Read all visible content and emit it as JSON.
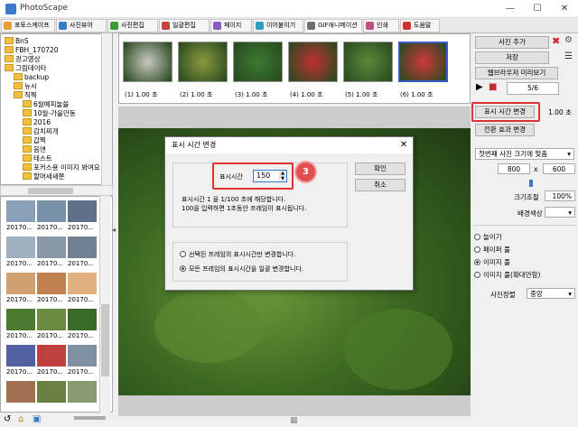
{
  "app": {
    "title": "PhotoScape"
  },
  "tabs": [
    {
      "label": "포토스케이프",
      "color": "#e8a030"
    },
    {
      "label": "사진뷰어",
      "color": "#3a78c8"
    },
    {
      "label": "사진편집",
      "color": "#3a9a3a"
    },
    {
      "label": "일괄편집",
      "color": "#c84040"
    },
    {
      "label": "페이지",
      "color": "#8a5ac8"
    },
    {
      "label": "이어붙이기",
      "color": "#30a0c0"
    },
    {
      "label": "GIF애니메이션",
      "color": "#707070"
    },
    {
      "label": "인쇄",
      "color": "#c05080"
    },
    {
      "label": "도움말",
      "color": "#d03030"
    }
  ],
  "tree": {
    "items": [
      {
        "label": "BnS",
        "indent": 0
      },
      {
        "label": "FBH_170720",
        "indent": 0
      },
      {
        "label": "광고영상",
        "indent": 0
      },
      {
        "label": "그림데이타",
        "indent": 0
      },
      {
        "label": "backup",
        "indent": 1
      },
      {
        "label": "뉴시",
        "indent": 1
      },
      {
        "label": "직찍",
        "indent": 1
      },
      {
        "label": "6월예피눌쓸",
        "indent": 2
      },
      {
        "label": "10월-가을만동",
        "indent": 2
      },
      {
        "label": "2016",
        "indent": 2
      },
      {
        "label": "감치찌개",
        "indent": 2
      },
      {
        "label": "갑찍",
        "indent": 2
      },
      {
        "label": "음앤",
        "indent": 2
      },
      {
        "label": "테스트",
        "indent": 2
      },
      {
        "label": "포커스용 이미지 봐여요",
        "indent": 2
      },
      {
        "label": "할머새새쭌",
        "indent": 2
      }
    ]
  },
  "thumbs": {
    "labels": [
      "20170...",
      "20170...",
      "20170..."
    ],
    "colors": [
      "#8aa0b8",
      "#7890a8",
      "#607088",
      "#a0b0c0",
      "#8898a8",
      "#708090",
      "#d0a070",
      "#c08050",
      "#e0b080",
      "#4a7a30",
      "#6a8a40",
      "#3a6a28",
      "#5060a0",
      "#c04040",
      "#8090a0",
      "#a07050",
      "#6a8040",
      "#8a9a70"
    ]
  },
  "frames": {
    "items": [
      {
        "label": "(1) 1.00 초",
        "color": "#c8c8c0"
      },
      {
        "label": "(2) 1.00 초",
        "color": "#8a9a40"
      },
      {
        "label": "(3) 1.00 초",
        "color": "#3a7a30"
      },
      {
        "label": "(4) 1.00 초",
        "color": "#c03030"
      },
      {
        "label": "(5) 1.00 초",
        "color": "#5a8a3a"
      },
      {
        "label": "(6) 1.00 초",
        "color": "#d03838"
      }
    ]
  },
  "right": {
    "add_photo": "사진 추가",
    "save": "저장",
    "web_preview": "웹브라우저 미리보기",
    "counter": "5/6",
    "change_time": "표시 시간 변경",
    "time_value": "1.00 초",
    "transition": "전환 효과 변경",
    "size_mode": "첫번째 사진 크기에 맞춤",
    "width": "800",
    "x": "x",
    "height": "600",
    "zoom_label": "크기조절",
    "zoom_value": "100%",
    "bg_label": "배경색상",
    "radios": [
      "늘이기",
      "페이퍼 풀",
      "이미지 풀",
      "이미지 풀(확대안함)"
    ],
    "selected_radio": 2,
    "align_label": "사진정렬",
    "align_value": "중앙"
  },
  "dialog": {
    "title": "표시 시간 변경",
    "field_label": "표시시간",
    "field_value": "150",
    "desc1": "표시시간 1 을 1/100 초에 해당합니다.",
    "desc2": "100을 입력하면 1초동안 프레임이 표시됩니다.",
    "ok": "확인",
    "cancel": "취소",
    "opt1": "선택된 프레임의 표시시간만 변경합니다.",
    "opt2": "모든 프레임의 표시시간을 일괄 변경합니다.",
    "selected_option": 2
  },
  "badge": "3"
}
